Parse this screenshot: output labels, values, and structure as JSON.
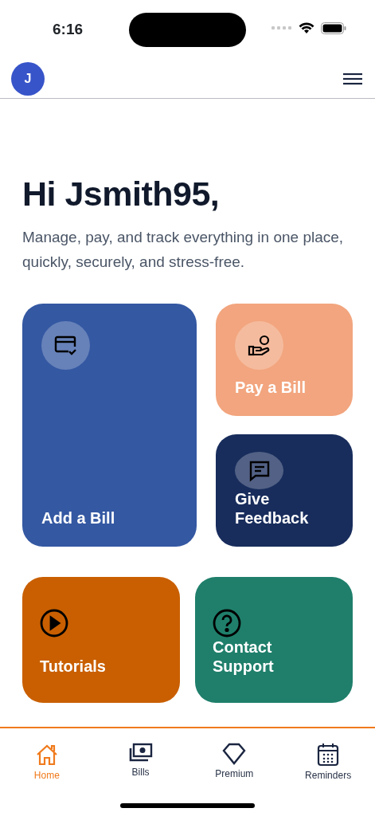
{
  "status_bar": {
    "time": "6:16"
  },
  "header": {
    "avatar": "J"
  },
  "greeting": {
    "title": "Hi Jsmith95,",
    "subtitle": "Manage, pay, and track everything in one place, quickly, securely, and stress-free."
  },
  "tiles": [
    {
      "label": "Add a Bill",
      "color": "#3458a2",
      "kind": "large"
    },
    {
      "label": "Pay a Bill",
      "color": "#f2a57e",
      "kind": "circle"
    },
    {
      "label": "Give Feedback",
      "color": "#182d5c",
      "kind": "circle"
    },
    {
      "label": "Tutorials",
      "color": "#c95f00",
      "kind": "plain"
    },
    {
      "label": "Contact Support",
      "color": "#1f7f6b",
      "kind": "plain"
    }
  ],
  "tab_bar": [
    {
      "label": "Home",
      "selected": true
    },
    {
      "label": "Bills",
      "selected": false
    },
    {
      "label": "Premium",
      "selected": false
    },
    {
      "label": "Reminders",
      "selected": false
    }
  ]
}
